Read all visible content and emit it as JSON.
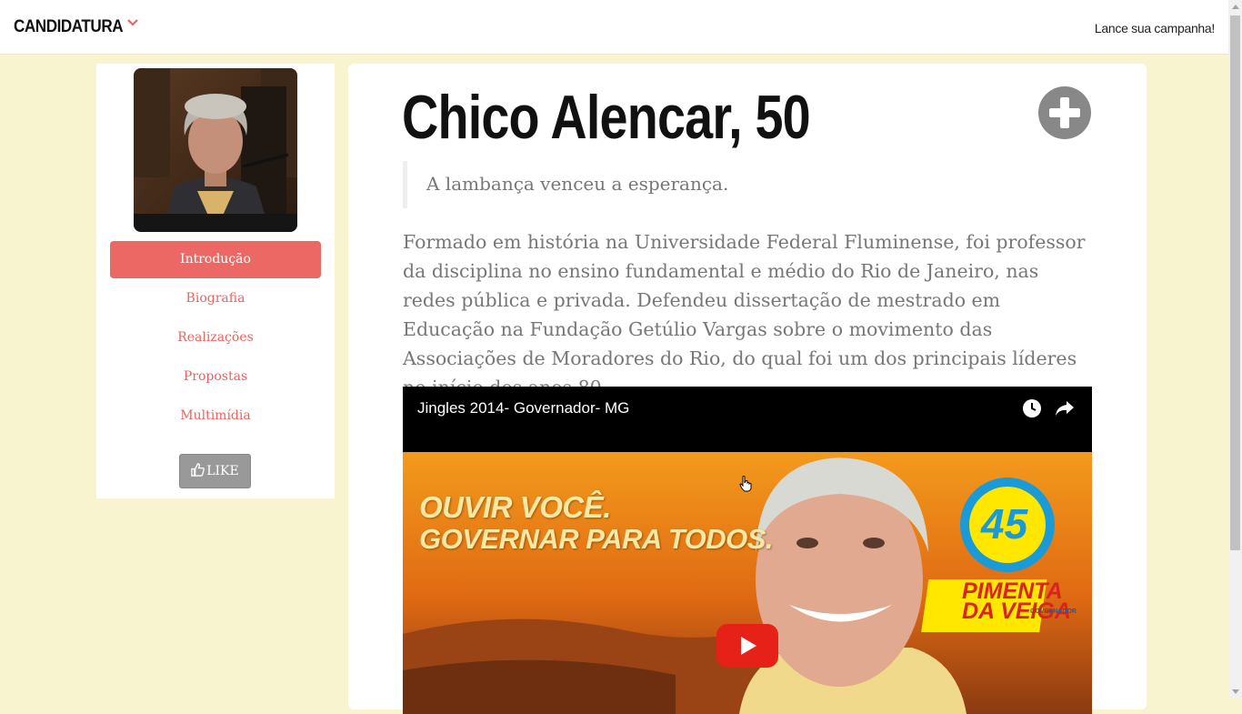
{
  "navbar": {
    "brand": "CANDIDATURA",
    "launch_link": "Lance sua campanha!"
  },
  "sidebar": {
    "items": [
      {
        "label": "Introdução",
        "active": true
      },
      {
        "label": "Biografia",
        "active": false
      },
      {
        "label": "Realizações",
        "active": false
      },
      {
        "label": "Propostas",
        "active": false
      },
      {
        "label": "Multimídia",
        "active": false
      }
    ],
    "like_label": "LIKE"
  },
  "main": {
    "candidate_name": "Chico Alencar, 50",
    "quote": "A lambança venceu a esperança.",
    "bio": "Formado em história na Universidade Federal Fluminense, foi professor da disciplina no ensino fundamental e médio do Rio de Janeiro, nas redes pública e privada. Defendeu dissertação de mestrado em Educação na Fundação Getúlio Vargas sobre o movimento das Associações de Moradores do Rio, do qual foi um dos principais líderes no início dos anos 80."
  },
  "video": {
    "title": "Jingles 2014- Governador- MG",
    "thumbnail_line1": "OUVIR VOCÊ.",
    "thumbnail_line2": "GOVERNAR PARA TODOS.",
    "badge_number": "45",
    "badge_name_line1": "PIMENTA",
    "badge_name_line2": "DA VEIGA",
    "badge_sub": "GOVERNADOR"
  },
  "colors": {
    "page_background": "#f8f4cf",
    "accent": "#eb6864",
    "youtube_red": "#e62117"
  },
  "icons": [
    "chevron-down-icon",
    "thumbs-up-icon",
    "plus-circle-icon",
    "clock-icon",
    "share-icon",
    "play-icon",
    "hand-cursor-icon"
  ]
}
